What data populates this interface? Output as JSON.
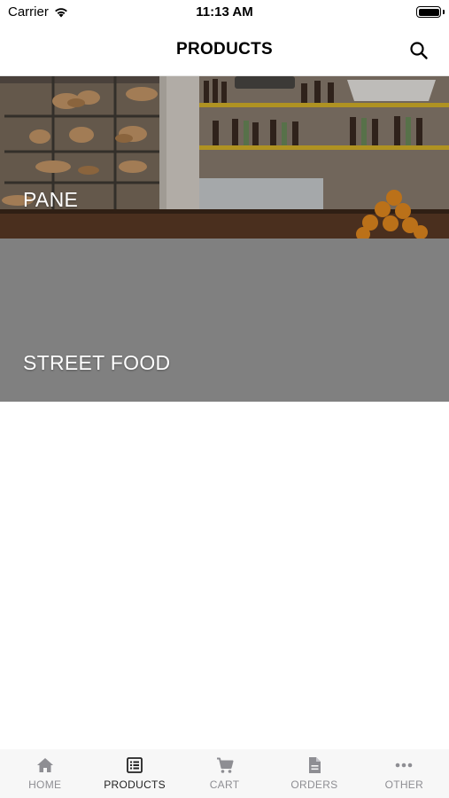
{
  "status_bar": {
    "carrier": "Carrier",
    "time": "11:13 AM"
  },
  "header": {
    "title": "PRODUCTS",
    "search_icon": "search-icon"
  },
  "categories": [
    {
      "label": "PANE",
      "background": "photo-bakery-bar"
    },
    {
      "label": "STREET FOOD",
      "background": "#808080"
    }
  ],
  "tabs": [
    {
      "label": "HOME",
      "icon": "home-icon",
      "active": false
    },
    {
      "label": "PRODUCTS",
      "icon": "list-icon",
      "active": true
    },
    {
      "label": "CART",
      "icon": "cart-icon",
      "active": false
    },
    {
      "label": "ORDERS",
      "icon": "document-icon",
      "active": false
    },
    {
      "label": "OTHER",
      "icon": "more-icon",
      "active": false
    }
  ],
  "colors": {
    "active_tab": "#222222",
    "inactive_tab": "#8e8e93",
    "card_gray": "#808080"
  }
}
